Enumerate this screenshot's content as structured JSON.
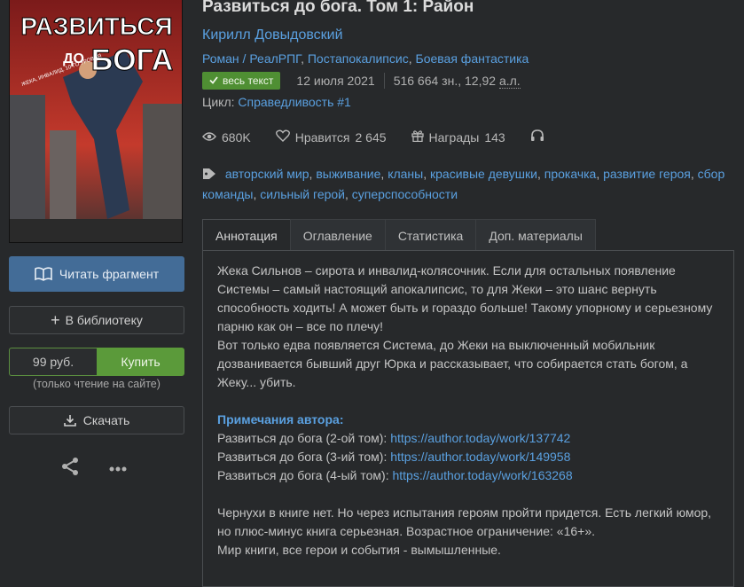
{
  "book": {
    "title": "Развиться до бога. Том 1: Район",
    "author": "Кирилл Довыдовский",
    "genres": [
      "Роман / РеалРПГ",
      "Постапокалипсис",
      "Боевая фантастика"
    ],
    "status_badge": "весь текст",
    "date": "12 июля 2021",
    "size": "516 664 зн., 12,92",
    "size_unit": "а.л.",
    "cycle_label": "Цикл:",
    "cycle": "Справедливость #1",
    "cover_text": {
      "line1": "РАЗВИТЬСЯ",
      "line2": "ДО",
      "line3": "БОГА",
      "small": "ЖЕКА, ИНВАЛИД. 10-ГО УРОВНЯ"
    }
  },
  "stats": {
    "views": "680K",
    "likes_label": "Нравится",
    "likes": "2 645",
    "awards_label": "Награды",
    "awards": "143"
  },
  "tags": [
    "авторский мир",
    "выживание",
    "кланы",
    "красивые девушки",
    "прокачка",
    "развитие героя",
    "сбор команды",
    "сильный герой",
    "суперспособности"
  ],
  "tabs": [
    "Аннотация",
    "Оглавление",
    "Статистика",
    "Доп. материалы"
  ],
  "annotation": {
    "p1": "Жека Сильнов – сирота и инвалид-колясочник. Если для остальных появление Системы – самый настоящий апокалипсис, то для Жеки – это шанс вернуть способность ходить! А может быть и гораздо больше! Такому упорному и серьезному парню как он – все по плечу!",
    "p2": "Вот только едва появляется Система, до Жеки на выключенный мобильник дозванивается бывший друг Юрка и рассказывает, что собирается стать богом, а Жеку... убить.",
    "notes_title": "Примечания автора:",
    "links": [
      {
        "label": "Развиться до бога (2-ой том):",
        "url": "https://author.today/work/137742"
      },
      {
        "label": "Развиться до бога (3-ий том):",
        "url": "https://author.today/work/149958"
      },
      {
        "label": "Развиться до бога (4-ый том):",
        "url": "https://author.today/work/163268"
      }
    ],
    "p3": "Чернухи в книге нет. Но через испытания героям пройти придется. Есть легкий юмор, но плюс-минус книга серьезная. Возрастное ограничение: «16+».",
    "p4": "Мир книги, все герои и события - вымышленные."
  },
  "actions": {
    "read": "Читать фрагмент",
    "library": "В библиотеку",
    "price": "99 руб.",
    "buy": "Купить",
    "buy_note": "(только чтение на сайте)",
    "download": "Скачать"
  }
}
